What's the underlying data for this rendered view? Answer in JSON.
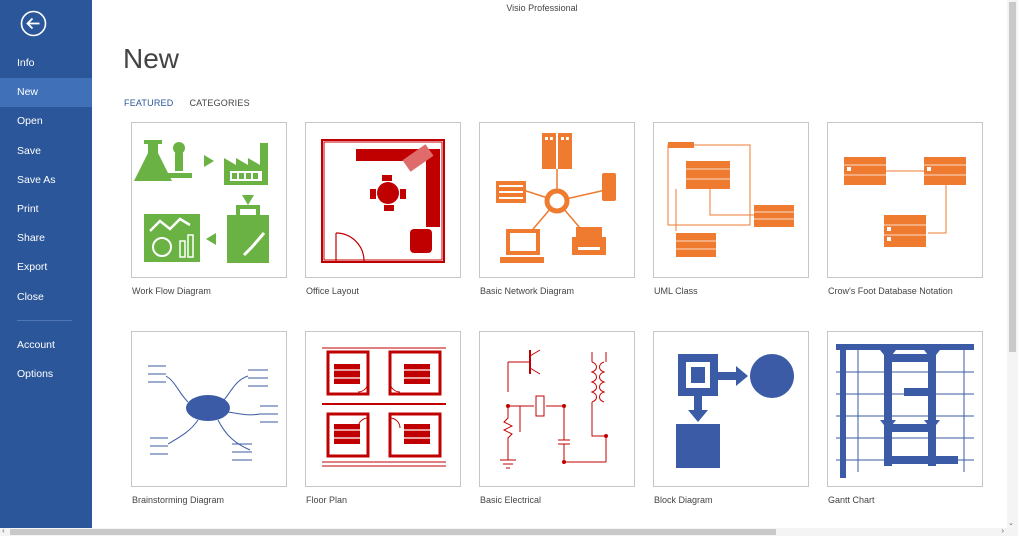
{
  "app": {
    "title": "Visio Professional"
  },
  "sidebar": {
    "items": [
      {
        "label": "Info",
        "active": false
      },
      {
        "label": "New",
        "active": true
      },
      {
        "label": "Open",
        "active": false
      },
      {
        "label": "Save",
        "active": false
      },
      {
        "label": "Save As",
        "active": false
      },
      {
        "label": "Print",
        "active": false
      },
      {
        "label": "Share",
        "active": false
      },
      {
        "label": "Export",
        "active": false
      },
      {
        "label": "Close",
        "active": false
      }
    ],
    "bottom_items": [
      {
        "label": "Account"
      },
      {
        "label": "Options"
      }
    ],
    "back_icon": "back-arrow-circle-icon"
  },
  "main": {
    "title": "New",
    "tabs": [
      {
        "label": "FEATURED",
        "active": true
      },
      {
        "label": "CATEGORIES",
        "active": false
      }
    ],
    "templates": [
      {
        "label": "Work Flow Diagram",
        "icon": "workflow-thumbnail"
      },
      {
        "label": "Office Layout",
        "icon": "office-layout-thumbnail"
      },
      {
        "label": "Basic Network Diagram",
        "icon": "network-thumbnail"
      },
      {
        "label": "UML Class",
        "icon": "uml-class-thumbnail"
      },
      {
        "label": "Crow's Foot Database Notation",
        "icon": "database-thumbnail"
      },
      {
        "label": "Brainstorming Diagram",
        "icon": "brainstorm-thumbnail"
      },
      {
        "label": "Floor Plan",
        "icon": "floor-plan-thumbnail"
      },
      {
        "label": "Basic Electrical",
        "icon": "electrical-thumbnail"
      },
      {
        "label": "Block Diagram",
        "icon": "block-diagram-thumbnail"
      },
      {
        "label": "Gantt Chart",
        "icon": "gantt-thumbnail"
      }
    ]
  },
  "colors": {
    "sidebar": "#2b579a",
    "sidebar_active": "#3f70b8",
    "accent": "#2b579a",
    "workflow_green": "#6ab244",
    "office_red": "#c00000",
    "network_orange": "#ee7b30",
    "diagram_blue": "#3b5ba6"
  }
}
